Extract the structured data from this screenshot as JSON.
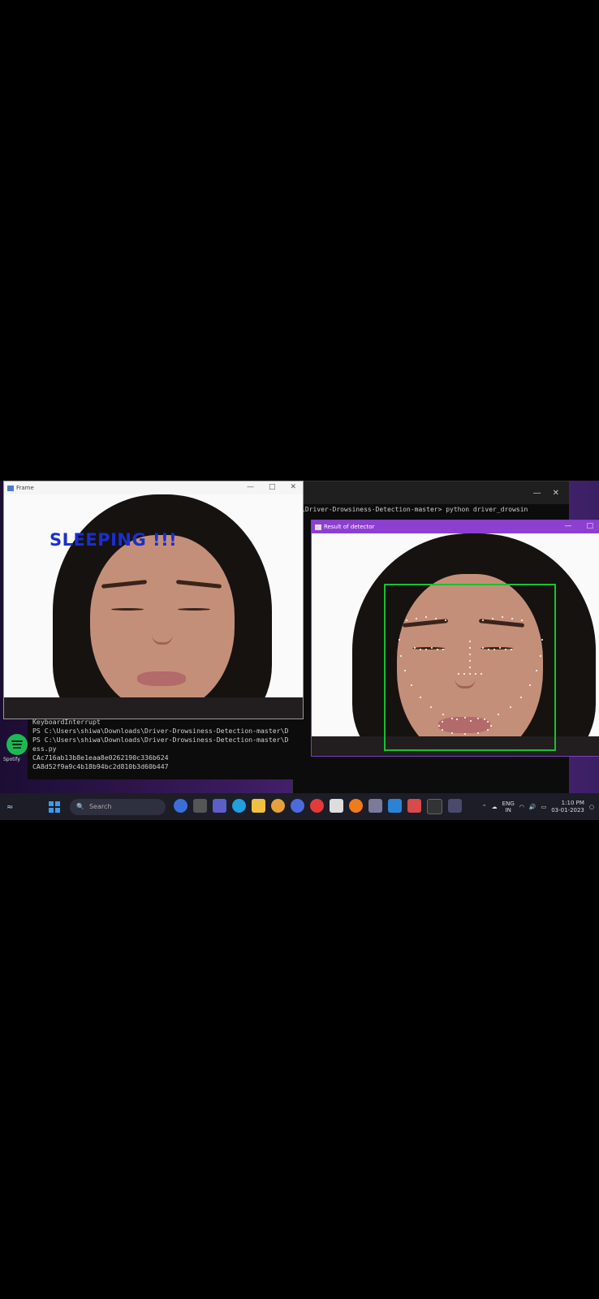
{
  "frame_window": {
    "title": "Frame",
    "alert_text": "SLEEPING !!!"
  },
  "landmark_window": {
    "title": "Result of detector"
  },
  "terminal": {
    "command": "\\Driver-Drowsiness-Detection-master> python driver_drowsin"
  },
  "console_lines": [
    "KeyboardInterrupt",
    "PS C:\\Users\\shiwa\\Downloads\\Driver-Drowsiness-Detection-master\\D",
    "PS C:\\Users\\shiwa\\Downloads\\Driver-Drowsiness-Detection-master\\D",
    "ess.py",
    "CAc716ab13b8e1eaa8e0262190c336b624",
    "CA8d52f9a9c4b18b94bc2d810b3d60b447"
  ],
  "taskbar": {
    "search_placeholder": "Search",
    "clock_time": "1:10 PM",
    "clock_date": "03-01-2023",
    "lang_top": "ENG",
    "lang_bottom": "IN"
  },
  "desktop": {
    "spotify_label": "Spotify"
  },
  "colors": {
    "alert_text": "#1b2ed2",
    "bounding_box": "#17c32a",
    "landmark_title_bar": "#8d3fd0"
  }
}
